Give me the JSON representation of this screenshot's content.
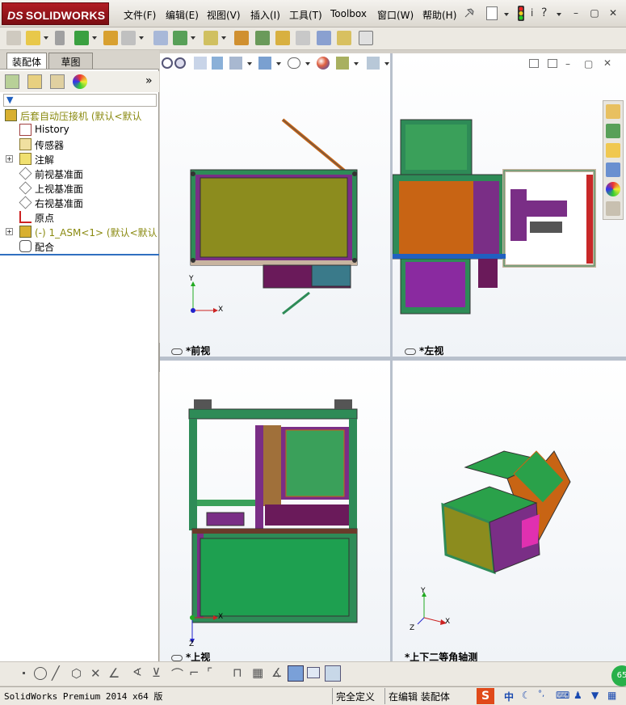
{
  "app": {
    "logo_text": "SOLIDWORKS",
    "logo_prefix": "DS"
  },
  "menu": {
    "items": [
      "文件(F)",
      "编辑(E)",
      "视图(V)",
      "插入(I)",
      "工具(T)",
      "Toolbox",
      "窗口(W)",
      "帮助(H)"
    ]
  },
  "left_panel": {
    "tabs": [
      "装配体",
      "草图"
    ],
    "tree": [
      {
        "label": "后套自动压接机  (默认<默认",
        "icon": "assembly-warning-icon",
        "expandable": false,
        "indent": 0
      },
      {
        "label": "History",
        "icon": "history-icon",
        "expandable": false,
        "indent": 1
      },
      {
        "label": "传感器",
        "icon": "sensor-icon",
        "expandable": false,
        "indent": 1
      },
      {
        "label": "注解",
        "icon": "annotation-icon",
        "expandable": true,
        "indent": 1
      },
      {
        "label": "前视基准面",
        "icon": "plane-icon",
        "expandable": false,
        "indent": 1
      },
      {
        "label": "上视基准面",
        "icon": "plane-icon",
        "expandable": false,
        "indent": 1
      },
      {
        "label": "右视基准面",
        "icon": "plane-icon",
        "expandable": false,
        "indent": 1
      },
      {
        "label": "原点",
        "icon": "origin-icon",
        "expandable": false,
        "indent": 1
      },
      {
        "label": "(-) 1_ASM<1> (默认<默认",
        "icon": "subassembly-warning-icon",
        "expandable": true,
        "indent": 1
      },
      {
        "label": "配合",
        "icon": "mates-icon",
        "expandable": false,
        "indent": 1
      }
    ]
  },
  "viewports": {
    "front": {
      "label": "*前视"
    },
    "left": {
      "label": "*左视"
    },
    "top": {
      "label": "*上视"
    },
    "iso": {
      "label": "*上下二等角轴测"
    }
  },
  "axes": {
    "x": "X",
    "y": "Y",
    "z": "Z"
  },
  "status": {
    "product": "SolidWorks Premium 2014 x64 版",
    "constraint": "完全定义",
    "editing": "在编辑 装配体",
    "ime": "中",
    "badge": "65"
  },
  "colors": {
    "olive": "#8c8c1e",
    "green": "#2aa14a",
    "frame": "#2e8b57",
    "purple": "#7a2e86",
    "orange": "#c86414"
  }
}
